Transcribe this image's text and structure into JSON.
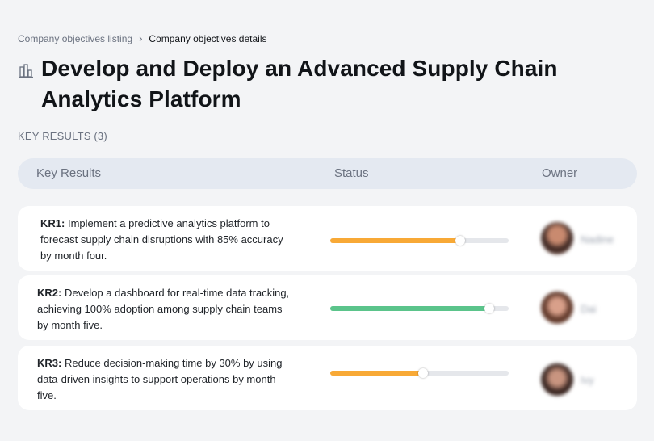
{
  "breadcrumb": {
    "parent_label": "Company objectives listing",
    "separator": "›",
    "current_label": "Company objectives details"
  },
  "objective": {
    "icon": "building-chart-icon",
    "title": "Develop and Deploy an Advanced Supply Chain Analytics Platform"
  },
  "key_results_section": {
    "label": "KEY RESULTS (3)"
  },
  "table_header": {
    "key_results": "Key Results",
    "status": "Status",
    "owner": "Owner"
  },
  "colors": {
    "amber": "#f8a936",
    "green": "#5bc48b",
    "track": "#e5e7eb"
  },
  "key_results": [
    {
      "code": "KR1:",
      "text": "Implement a predictive analytics platform to forecast supply chain disruptions with 85% accuracy by month four.",
      "progress": 0.73,
      "status_color": "#f8a936",
      "owner": "Nadine"
    },
    {
      "code": "KR2:",
      "text": "Develop a dashboard for real-time data tracking, achieving 100% adoption among supply chain teams by month five.",
      "progress": 0.89,
      "status_color": "#5bc48b",
      "owner": "Dai"
    },
    {
      "code": "KR3:",
      "text": "Reduce decision-making time by 30% by using data-driven insights to support operations by month five.",
      "progress": 0.52,
      "status_color": "#f8a936",
      "owner": "Ivy"
    }
  ]
}
